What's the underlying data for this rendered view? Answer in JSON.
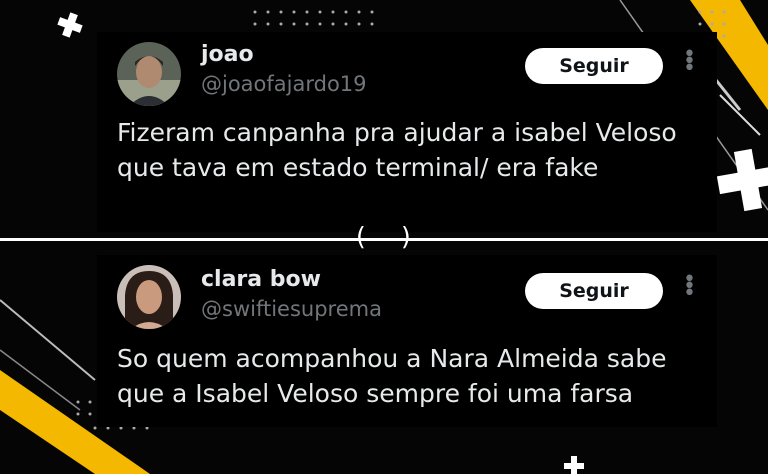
{
  "posts": [
    {
      "name": "joao",
      "handle": "@joaofajardo19",
      "follow_label": "Seguir",
      "text": "Fizeram canpanha pra ajudar a isabel Veloso que tava em estado terminal/ era fake"
    },
    {
      "name": "clara bow",
      "handle": "@swiftiesuprema",
      "follow_label": "Seguir",
      "text": "So quem acompanhou a Nara Almeida sabe que a Isabel Veloso sempre foi uma farsa"
    }
  ],
  "divider": {
    "open_paren": "(",
    "close_paren": ")"
  },
  "icons": [
    "plus-icon",
    "more-options-icon",
    "avatar"
  ],
  "colors": {
    "background": "#000000",
    "accent_yellow": "#f5b800",
    "text_primary": "#e7e9ea",
    "text_secondary": "#71767b",
    "button_bg": "#ffffff"
  }
}
